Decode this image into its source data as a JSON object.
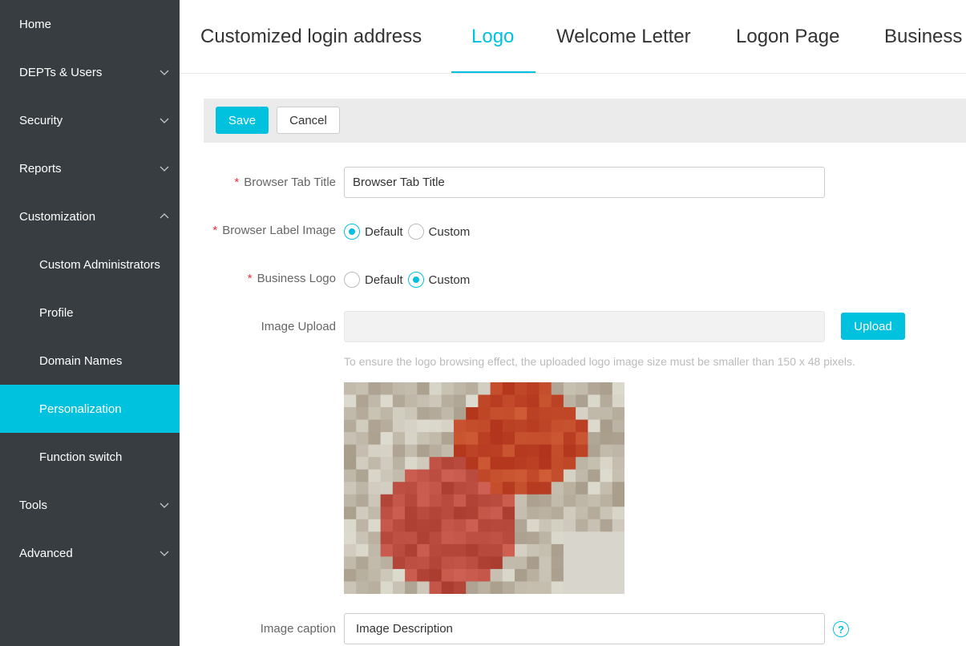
{
  "sidebar": {
    "items": [
      {
        "label": "Home"
      },
      {
        "label": "DEPTs & Users"
      },
      {
        "label": "Security"
      },
      {
        "label": "Reports"
      },
      {
        "label": "Customization"
      },
      {
        "label": "Custom Administrators"
      },
      {
        "label": "Profile"
      },
      {
        "label": "Domain Names"
      },
      {
        "label": "Personalization"
      },
      {
        "label": "Function switch"
      },
      {
        "label": "Tools"
      },
      {
        "label": "Advanced"
      }
    ],
    "active": "Personalization"
  },
  "tabs": [
    {
      "label": "Customized login address"
    },
    {
      "label": "Logo"
    },
    {
      "label": "Welcome Letter"
    },
    {
      "label": "Logon Page"
    },
    {
      "label": "Business"
    }
  ],
  "active_tab": "Logo",
  "toolbar": {
    "save_label": "Save",
    "cancel_label": "Cancel"
  },
  "form": {
    "browser_tab_title": {
      "label": "Browser Tab Title",
      "value": "Browser Tab Title"
    },
    "browser_label_image": {
      "label": "Browser Label Image",
      "options": [
        "Default",
        "Custom"
      ],
      "selected": "Default"
    },
    "business_logo": {
      "label": "Business Logo",
      "options": [
        "Default",
        "Custom"
      ],
      "selected": "Custom"
    },
    "image_upload": {
      "label": "Image Upload",
      "value": "",
      "button": "Upload"
    },
    "hint": "To ensure the logo browsing effect, the uploaded logo image size must be smaller than 150 x 48 pixels.",
    "image_caption": {
      "label": "Image caption",
      "value": "Image Description"
    },
    "required_mark": "*",
    "help_glyph": "?"
  },
  "colors": {
    "accent": "#00c1de",
    "sidebar_bg": "#373d41",
    "required": "#e5323e"
  }
}
